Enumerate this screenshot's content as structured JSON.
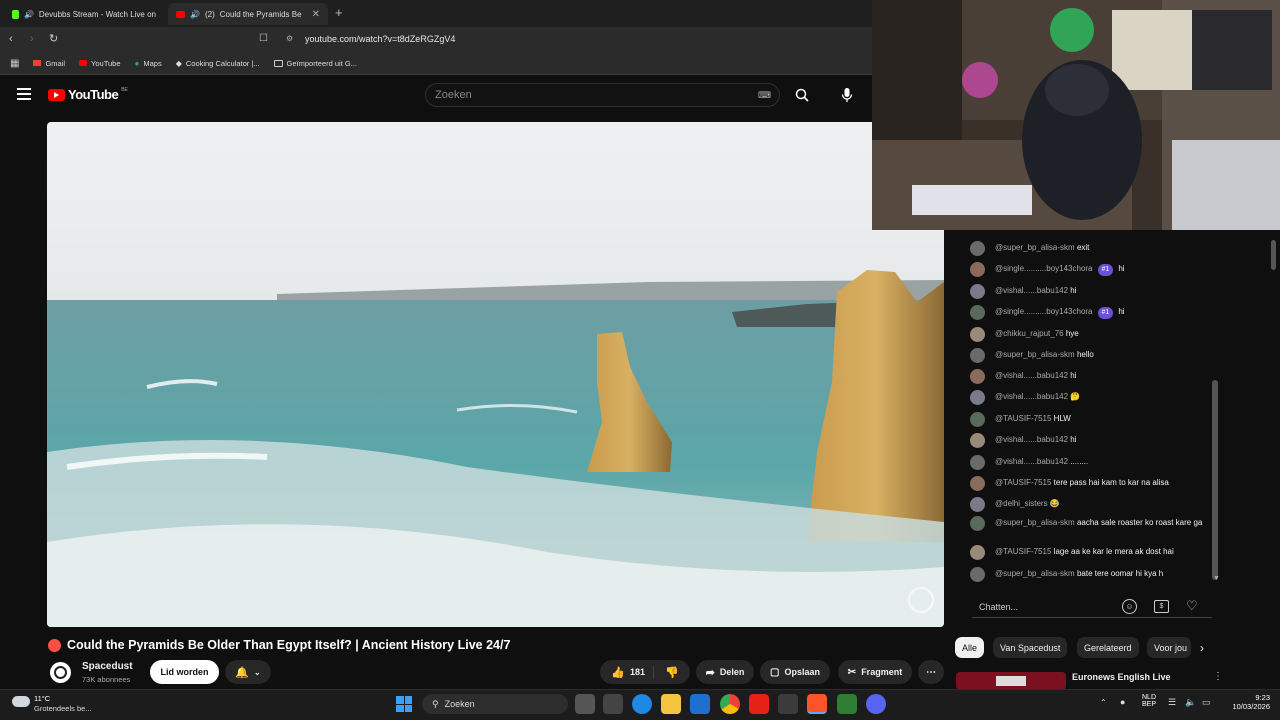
{
  "browser": {
    "tabs": [
      {
        "title": "Devubbs Stream - Watch Live on",
        "color": "#53fc18"
      },
      {
        "title": "(2)",
        "subtitle": "Could the Pyramids Be",
        "color": "#ff0000"
      }
    ],
    "address": "youtube.com/watch?v=t8dZeRGZgV4",
    "bookmarks": [
      "Gmail",
      "YouTube",
      "Maps",
      "Cooking Calculator |...",
      "Geïmporteerd uit G..."
    ]
  },
  "youtube": {
    "logo": "YouTube",
    "region": "BE",
    "search_placeholder": "Zoeken"
  },
  "video": {
    "title": "Could the Pyramids Be Older Than Egypt Itself? | Ancient History Live 24/7",
    "live_dot_color": "#ff4e45"
  },
  "channel": {
    "name": "Spacedust",
    "subs": "73K abonnees",
    "join_label": "Lid worden"
  },
  "actions": {
    "likes": "181",
    "share": "Delen",
    "save": "Opslaan",
    "clip": "Fragment"
  },
  "chat": {
    "messages": [
      {
        "author": "@super_bp_alisa-skm",
        "text": "exit",
        "badge": ""
      },
      {
        "author": "@single..........boy143chora",
        "text": "hi",
        "badge": "#1"
      },
      {
        "author": "@vishal......babu142",
        "text": "hi",
        "badge": ""
      },
      {
        "author": "@single..........boy143chora",
        "text": "hi",
        "badge": "#1"
      },
      {
        "author": "@chikku_rajput_76",
        "text": "hye",
        "badge": ""
      },
      {
        "author": "@super_bp_alisa-skm",
        "text": "hello",
        "badge": ""
      },
      {
        "author": "@vishal......babu142",
        "text": "hi",
        "badge": ""
      },
      {
        "author": "@vishal......babu142",
        "text": "🤔",
        "badge": ""
      },
      {
        "author": "@TAUSIF-7515",
        "text": "HLW",
        "badge": ""
      },
      {
        "author": "@vishal......babu142",
        "text": "hi",
        "badge": ""
      },
      {
        "author": "@vishal......babu142",
        "text": "........",
        "badge": ""
      },
      {
        "author": "@TAUSIF-7515",
        "text": "tere pass hai kam to kar na alisa",
        "badge": ""
      },
      {
        "author": "@delhi_sisters",
        "text": "😂",
        "badge": ""
      },
      {
        "author": "@super_bp_alisa-skm",
        "text": "aacha sale roaster ko roast kare ga",
        "badge": ""
      },
      {
        "author": "@TAUSIF-7515",
        "text": "lage aa ke kar le mera ak dost hai",
        "badge": ""
      },
      {
        "author": "@super_bp_alisa-skm",
        "text": "bate tere oomar hi kya h",
        "badge": ""
      }
    ],
    "input_placeholder": "Chatten..."
  },
  "filters": [
    "Alle",
    "Van Spacedust",
    "Gerelateerd",
    "Voor jou"
  ],
  "next_video": {
    "title": "Euronews English Live"
  },
  "taskbar": {
    "weather_temp": "11°C",
    "weather_desc": "Grotendeels be...",
    "search": "Zoeken",
    "lang": "NLD",
    "lang2": "BEP",
    "time": "9:23",
    "date": "10/03/2026"
  }
}
